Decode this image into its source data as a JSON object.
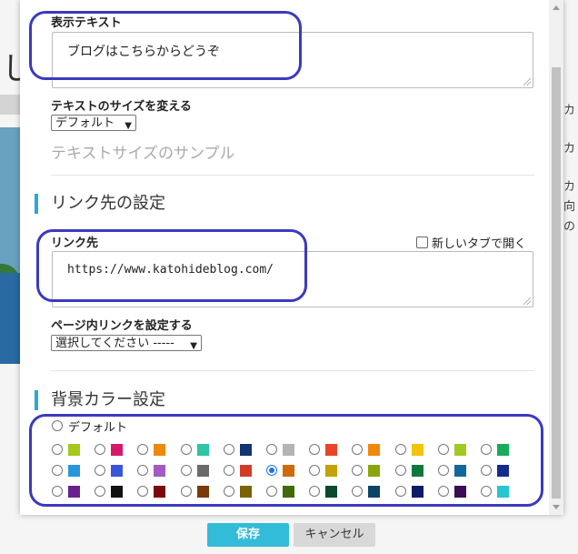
{
  "background": {
    "big_letter": "し",
    "right_text": [
      "カ",
      "カ",
      "カ",
      "向",
      "の"
    ]
  },
  "display_text": {
    "label": "表示テキスト",
    "value": "ブログはこちらからどうぞ"
  },
  "text_size": {
    "label": "テキストのサイズを変える",
    "selected": "デフォルト",
    "sample": "テキストサイズのサンプル"
  },
  "link_section": {
    "title": "リンク先の設定",
    "link_label": "リンク先",
    "new_tab_label": "新しいタブで開く",
    "url": "https://www.katohideblog.com/",
    "anchor_label": "ページ内リンクを設定する",
    "anchor_selected": "選択してください -----"
  },
  "bg_color_section": {
    "title": "背景カラー設定",
    "default_label": "デフォルト",
    "selected_index": 16,
    "swatches": [
      "#a5c81e",
      "#d6196b",
      "#ee8a0a",
      "#2ec4a5",
      "#12356e",
      "#b4b4b4",
      "#e8452a",
      "#f0870e",
      "#f3c409",
      "#a1c923",
      "#1aab5a",
      "#2896d9",
      "#3b55dc",
      "#a35bc1",
      "#6a6a6a",
      "#d13c26",
      "#cf6a07",
      "#c4a009",
      "#89a50b",
      "#0d7a3c",
      "#12689a",
      "#142b8e",
      "#6a1f8c",
      "#111111",
      "#7a0a0a",
      "#7a3b06",
      "#7a6205",
      "#3f6a05",
      "#0a4a2a",
      "#0a4466",
      "#0b1a6a",
      "#3a0e55",
      "#26c6d5"
    ]
  },
  "footer": {
    "save_label": "保存",
    "cancel_label": "キャンセル"
  },
  "colors": {
    "accent": "#2aa8d8",
    "save_button": "#33bcd8",
    "annotation": "#3a3abf"
  }
}
